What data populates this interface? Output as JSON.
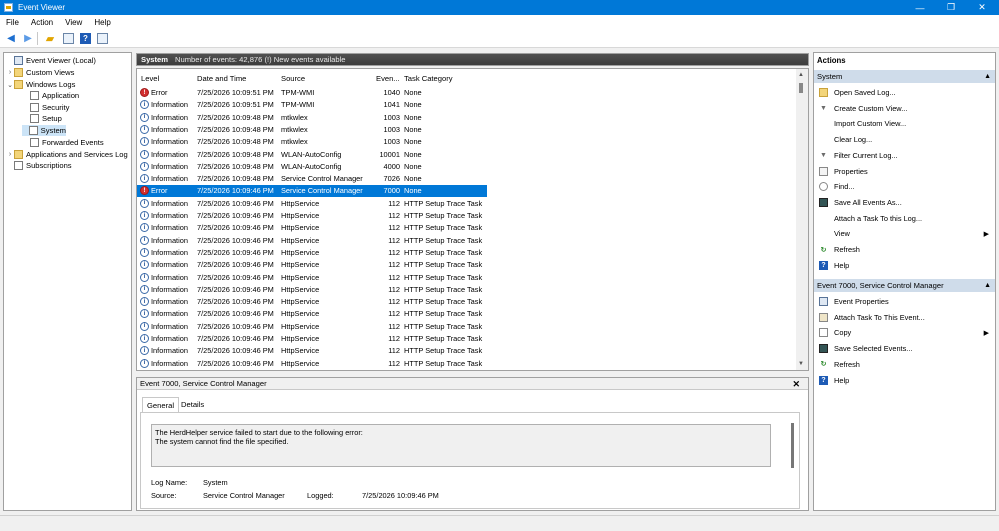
{
  "window": {
    "title": "Event Viewer",
    "controls": {
      "minimize": "—",
      "maximize": "❐",
      "close": "✕"
    }
  },
  "menu": [
    "File",
    "Action",
    "View",
    "Help"
  ],
  "toolbar": {
    "icons": [
      "back-icon",
      "forward-icon",
      "folder-up-icon",
      "console-tree-icon",
      "help-icon",
      "action-pane-icon"
    ]
  },
  "tree": {
    "items": [
      {
        "label": "Event Viewer (Local)",
        "icon": "event-viewer-icon"
      },
      {
        "label": "Custom Views",
        "chevron": "›",
        "icon": "folder-icon"
      },
      {
        "label": "Windows Logs",
        "chevron": "⌄",
        "icon": "folder-icon"
      },
      {
        "label": "Application",
        "icon": "log-icon"
      },
      {
        "label": "Security",
        "icon": "log-icon"
      },
      {
        "label": "Setup",
        "icon": "log-icon"
      },
      {
        "label": "System",
        "icon": "log-icon",
        "selected": true
      },
      {
        "label": "Forwarded Events",
        "icon": "log-icon"
      },
      {
        "label": "Applications and Services Log",
        "chevron": "›",
        "icon": "folder-icon"
      },
      {
        "label": "Subscriptions",
        "icon": "log-icon"
      }
    ]
  },
  "center": {
    "log_name": "System",
    "count_text": "Number of events: 42,876 (!) New events available",
    "columns": [
      "Level",
      "Date and Time",
      "Source",
      "Even...",
      "Task Category"
    ],
    "rows": [
      {
        "level": "Error",
        "date": "7/25/2026 10:09:51 PM",
        "source": "TPM-WMI",
        "id": "1040",
        "task": "None"
      },
      {
        "level": "Information",
        "date": "7/25/2026 10:09:51 PM",
        "source": "TPM-WMI",
        "id": "1041",
        "task": "None"
      },
      {
        "level": "Information",
        "date": "7/25/2026 10:09:48 PM",
        "source": "mtkwlex",
        "id": "1003",
        "task": "None"
      },
      {
        "level": "Information",
        "date": "7/25/2026 10:09:48 PM",
        "source": "mtkwlex",
        "id": "1003",
        "task": "None"
      },
      {
        "level": "Information",
        "date": "7/25/2026 10:09:48 PM",
        "source": "mtkwlex",
        "id": "1003",
        "task": "None"
      },
      {
        "level": "Information",
        "date": "7/25/2026 10:09:48 PM",
        "source": "WLAN-AutoConfig",
        "id": "10001",
        "task": "None"
      },
      {
        "level": "Information",
        "date": "7/25/2026 10:09:48 PM",
        "source": "WLAN-AutoConfig",
        "id": "4000",
        "task": "None"
      },
      {
        "level": "Information",
        "date": "7/25/2026 10:09:48 PM",
        "source": "Service Control Manager",
        "id": "7026",
        "task": "None"
      },
      {
        "level": "Error",
        "date": "7/25/2026 10:09:46 PM",
        "source": "Service Control Manager",
        "id": "7000",
        "task": "None",
        "selected": true
      },
      {
        "level": "Information",
        "date": "7/25/2026 10:09:46 PM",
        "source": "HttpService",
        "id": "112",
        "task": "HTTP Setup Trace Task"
      },
      {
        "level": "Information",
        "date": "7/25/2026 10:09:46 PM",
        "source": "HttpService",
        "id": "112",
        "task": "HTTP Setup Trace Task"
      },
      {
        "level": "Information",
        "date": "7/25/2026 10:09:46 PM",
        "source": "HttpService",
        "id": "112",
        "task": "HTTP Setup Trace Task"
      },
      {
        "level": "Information",
        "date": "7/25/2026 10:09:46 PM",
        "source": "HttpService",
        "id": "112",
        "task": "HTTP Setup Trace Task"
      },
      {
        "level": "Information",
        "date": "7/25/2026 10:09:46 PM",
        "source": "HttpService",
        "id": "112",
        "task": "HTTP Setup Trace Task"
      },
      {
        "level": "Information",
        "date": "7/25/2026 10:09:46 PM",
        "source": "HttpService",
        "id": "112",
        "task": "HTTP Setup Trace Task"
      },
      {
        "level": "Information",
        "date": "7/25/2026 10:09:46 PM",
        "source": "HttpService",
        "id": "112",
        "task": "HTTP Setup Trace Task"
      },
      {
        "level": "Information",
        "date": "7/25/2026 10:09:46 PM",
        "source": "HttpService",
        "id": "112",
        "task": "HTTP Setup Trace Task"
      },
      {
        "level": "Information",
        "date": "7/25/2026 10:09:46 PM",
        "source": "HttpService",
        "id": "112",
        "task": "HTTP Setup Trace Task"
      },
      {
        "level": "Information",
        "date": "7/25/2026 10:09:46 PM",
        "source": "HttpService",
        "id": "112",
        "task": "HTTP Setup Trace Task"
      },
      {
        "level": "Information",
        "date": "7/25/2026 10:09:46 PM",
        "source": "HttpService",
        "id": "112",
        "task": "HTTP Setup Trace Task"
      },
      {
        "level": "Information",
        "date": "7/25/2026 10:09:46 PM",
        "source": "HttpService",
        "id": "112",
        "task": "HTTP Setup Trace Task"
      },
      {
        "level": "Information",
        "date": "7/25/2026 10:09:46 PM",
        "source": "HttpService",
        "id": "112",
        "task": "HTTP Setup Trace Task"
      },
      {
        "level": "Information",
        "date": "7/25/2026 10:09:46 PM",
        "source": "HttpService",
        "id": "112",
        "task": "HTTP Setup Trace Task"
      }
    ]
  },
  "detail": {
    "title": "Event 7000, Service Control Manager",
    "close": "✕",
    "tabs": [
      "General",
      "Details"
    ],
    "message_line1": "The HerdHelper service failed to start due to the following error:",
    "message_line2": "The system cannot find the file specified.",
    "log_name_label": "Log Name:",
    "log_name_value": "System",
    "source_label": "Source:",
    "source_value": "Service Control Manager",
    "logged_label": "Logged:",
    "logged_value": "7/25/2026 10:09:46 PM"
  },
  "actions": {
    "header": "Actions",
    "section1": {
      "title": "System",
      "items": [
        {
          "label": "Open Saved Log...",
          "icon": "open-folder-icon"
        },
        {
          "label": "Create Custom View...",
          "icon": "filter-icon"
        },
        {
          "label": "Import Custom View...",
          "icon": ""
        },
        {
          "label": "Clear Log...",
          "icon": ""
        },
        {
          "label": "Filter Current Log...",
          "icon": "filter-icon"
        },
        {
          "label": "Properties",
          "icon": "properties-icon"
        },
        {
          "label": "Find...",
          "icon": "find-icon"
        },
        {
          "label": "Save All Events As...",
          "icon": "save-icon"
        },
        {
          "label": "Attach a Task To this Log...",
          "icon": ""
        },
        {
          "label": "View",
          "icon": "",
          "submenu": "▶"
        },
        {
          "label": "Refresh",
          "icon": "refresh-icon"
        },
        {
          "label": "Help",
          "icon": "help-icon",
          "submenu": "▶"
        }
      ]
    },
    "section2": {
      "title": "Event 7000, Service Control Manager",
      "items": [
        {
          "label": "Event Properties",
          "icon": "event-properties-icon"
        },
        {
          "label": "Attach Task To This Event...",
          "icon": "attach-task-icon"
        },
        {
          "label": "Copy",
          "icon": "copy-icon",
          "submenu": "▶"
        },
        {
          "label": "Save Selected Events...",
          "icon": "save-icon"
        },
        {
          "label": "Refresh",
          "icon": "refresh-icon"
        },
        {
          "label": "Help",
          "icon": "help-icon",
          "submenu": "▶"
        }
      ]
    },
    "collapse_glyph": "▲"
  }
}
